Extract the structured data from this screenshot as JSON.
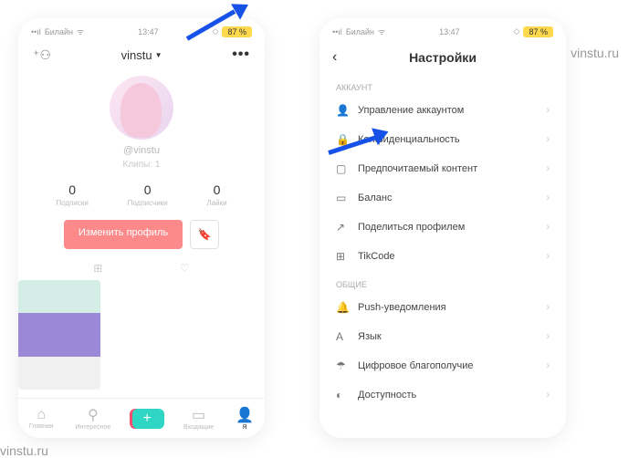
{
  "status": {
    "carrier": "Билайн",
    "time": "13:47",
    "battery": "87 %"
  },
  "profile": {
    "username": "vinstu",
    "handle": "@vinstu",
    "clips": "Клипы: 1",
    "stats": [
      {
        "num": "0",
        "label": "Подписки"
      },
      {
        "num": "0",
        "label": "Подписчики"
      },
      {
        "num": "0",
        "label": "Лайки"
      }
    ],
    "editButton": "Изменить профиль",
    "nav": [
      "Главная",
      "Интересное",
      "",
      "Входящие",
      "Я"
    ]
  },
  "settings": {
    "title": "Настройки",
    "sections": {
      "account": "АККАУНТ",
      "general": "ОБЩИЕ"
    },
    "accountItems": [
      {
        "icon": "👤",
        "label": "Управление аккаунтом"
      },
      {
        "icon": "🔒",
        "label": "Конфиденциальность"
      },
      {
        "icon": "▢",
        "label": "Предпочитаемый контент"
      },
      {
        "icon": "▭",
        "label": "Баланс"
      },
      {
        "icon": "↗",
        "label": "Поделиться профилем"
      },
      {
        "icon": "⊞",
        "label": "TikCode"
      }
    ],
    "generalItems": [
      {
        "icon": "🔔",
        "label": "Push-уведомления"
      },
      {
        "icon": "A",
        "label": "Язык"
      },
      {
        "icon": "☂",
        "label": "Цифровое благополучие"
      },
      {
        "icon": "◐",
        "label": "Доступность"
      }
    ]
  },
  "watermark": "vinstu.ru"
}
